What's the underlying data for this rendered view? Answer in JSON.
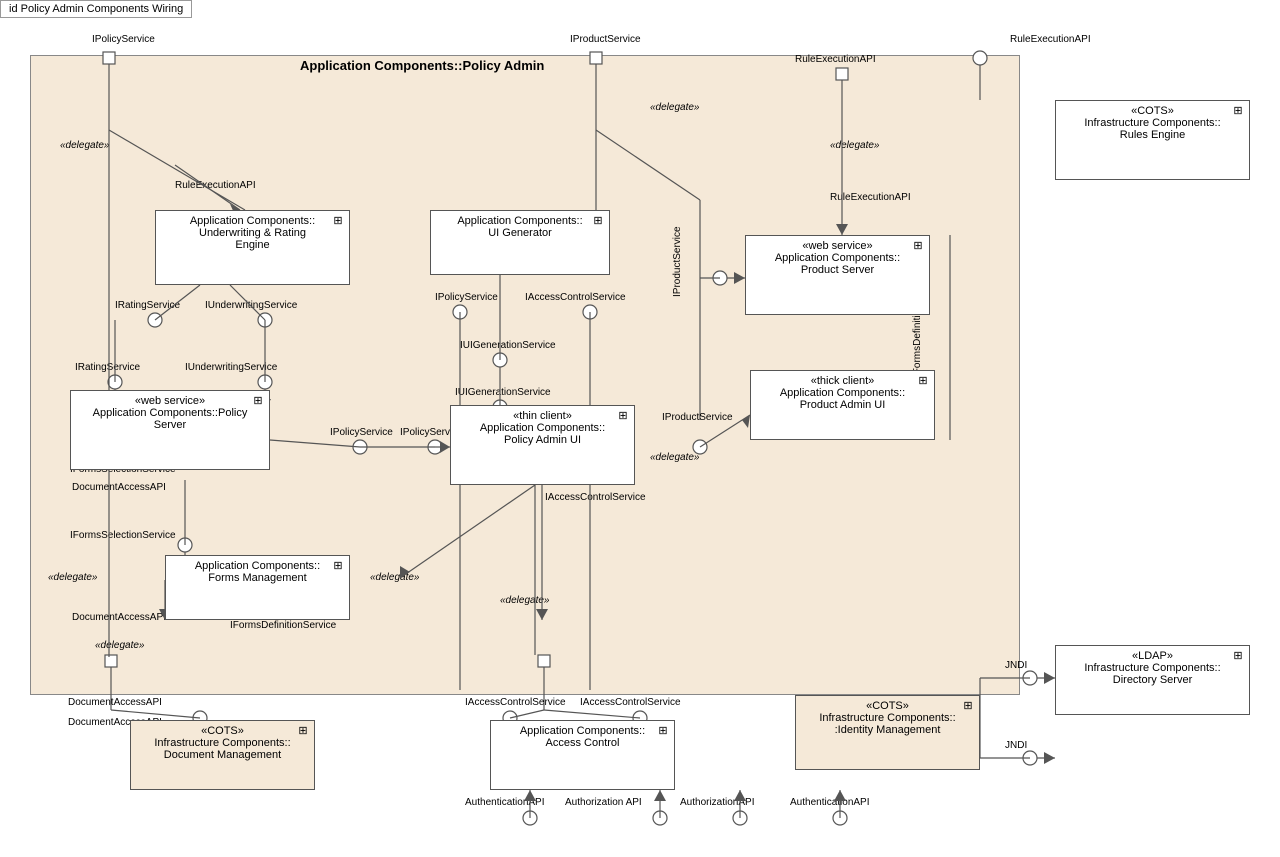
{
  "title": "id Policy Admin Components Wiring",
  "diagram": {
    "title": "Application Components::Policy Admin",
    "components": {
      "underwriting": {
        "stereotype": "",
        "name": "Application Components::\nUnderwriting & Rating\nEngine"
      },
      "ui_generator": {
        "stereotype": "",
        "name": "Application Components::\nUI Generator"
      },
      "policy_server": {
        "stereotype": "«web service»",
        "name": "Application Components::Policy\nServer"
      },
      "policy_admin_ui": {
        "stereotype": "«thin client»",
        "name": "Application Components::\nPolicy Admin UI"
      },
      "forms_management": {
        "stereotype": "",
        "name": "Application Components::\nForms Management"
      },
      "product_server": {
        "stereotype": "«web service»",
        "name": "Application Components::\nProduct Server"
      },
      "product_admin_ui": {
        "stereotype": "«thick client»",
        "name": "Application Components::\nProduct Admin UI"
      },
      "rules_engine": {
        "stereotype": "«COTS»",
        "name": "Infrastructure Components::\nRules Engine"
      },
      "access_control": {
        "stereotype": "",
        "name": "Application Components::\nAccess Control"
      },
      "document_management": {
        "stereotype": "«COTS»",
        "name": "Infrastructure Components::\nDocument Management"
      },
      "identity_management": {
        "stereotype": "«COTS»",
        "name": "Infrastructure Components::\n:Identity Management"
      },
      "directory_server": {
        "stereotype": "«LDAP»",
        "name": "Infrastructure Components::\nDirectory Server"
      }
    },
    "labels": {
      "IPolicyService_top": "IPolicyService",
      "IProductService_top": "IProductService",
      "RuleExecutionAPI_top1": "RuleExecutionAPI",
      "RuleExecutionAPI_top2": "RuleExecutionAPI",
      "delegate1": "«delegate»",
      "delegate2": "«delegate»",
      "delegate3": "«delegate»",
      "delegate4": "«delegate»",
      "delegate5": "«delegate»",
      "delegate6": "«delegate»",
      "RuleExecutionAPI_mid": "RuleExecutionAPI",
      "RuleExecutionAPI_mid2": "RuleExecutionAPI",
      "IRatingService1": "IRatingService",
      "IUnderwritingService1": "IUnderwritingService",
      "IRatingService2": "IRatingService",
      "IUnderwritingService2": "IUnderwritingService",
      "IPolicyService_mid1": "IPolicyService",
      "IAccessControlService1": "IAccessControlService",
      "IUIGenerationService1": "IUIGenerationService",
      "IUIGenerationService2": "IUIGenerationService",
      "IPolicyService_mid2": "IPolicyService",
      "IPolicyService_mid3": "IPolicyService",
      "IFormsSelectionService1": "IFormsSelectionService",
      "DocumentAccessAPI1": "DocumentAccessAPI",
      "IAccessControlService2": "IAccessControlService",
      "IFormsSelectionService2": "IFormsSelectionService",
      "DocumentAccessAPI2": "DocumentAccessAPI",
      "IFormsDefinitionService1": "IFormsDefinitionService",
      "IProductService_mid": "IProductService",
      "IProductService_mid2": "IProductService",
      "IProductService_mid3": "IProductService",
      "IFormsDefinitionService2": "IFormsDefinitionService",
      "IAccessControlService3": "IAccessControlService",
      "IAccessControlService4": "IAccessControlService",
      "DocumentAccessAPI3": "DocumentAccessAPI",
      "DocumentAccessAPI4": "DocumentAccessAPI",
      "AuthenticationAPI1": "AuthenticationAPI",
      "AuthorizationAPI1": "Authorization API",
      "AuthorizationAPI2": "AuthorizationAPI",
      "AuthenticationAPI2": "AuthenticationAPI",
      "JNDI1": "JNDI",
      "JNDI2": "JNDI"
    }
  }
}
